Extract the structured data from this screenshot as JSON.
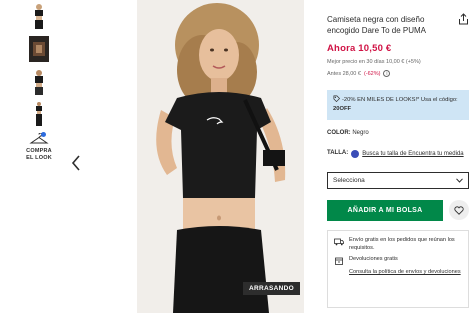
{
  "gallery": {
    "compare_label": "COMPRA EL LOOK",
    "badge": "ARRASANDO"
  },
  "product": {
    "title": "Camiseta negra con diseño encogido Dare To de PUMA",
    "price_now": "Ahora 10,50 €",
    "best_price": "Mejor precio en 30 días 10,00 € (+5%)",
    "before_price": "Antes 28,00 €",
    "discount": "(-62%)"
  },
  "promo": {
    "text": "-20% EN MILES DE LOOKS!* Usa el código:",
    "code": "20OFF"
  },
  "color": {
    "label": "COLOR:",
    "value": "Negro"
  },
  "size": {
    "label": "TALLA:",
    "fit_link": "Busca tu talla de Encuentra tu medida",
    "placeholder": "Selecciona"
  },
  "actions": {
    "add_to_bag": "AÑADIR A MI BOLSA"
  },
  "delivery": {
    "free_shipping": "Envío gratis en los pedidos que reúnan los requisitos.",
    "returns": "Devoluciones gratis",
    "policy_link": "Consulta la política de envíos y devoluciones"
  },
  "colors": {
    "accent_green": "#018849",
    "price_red": "#d01345",
    "promo_bg": "#cfe5f5"
  }
}
